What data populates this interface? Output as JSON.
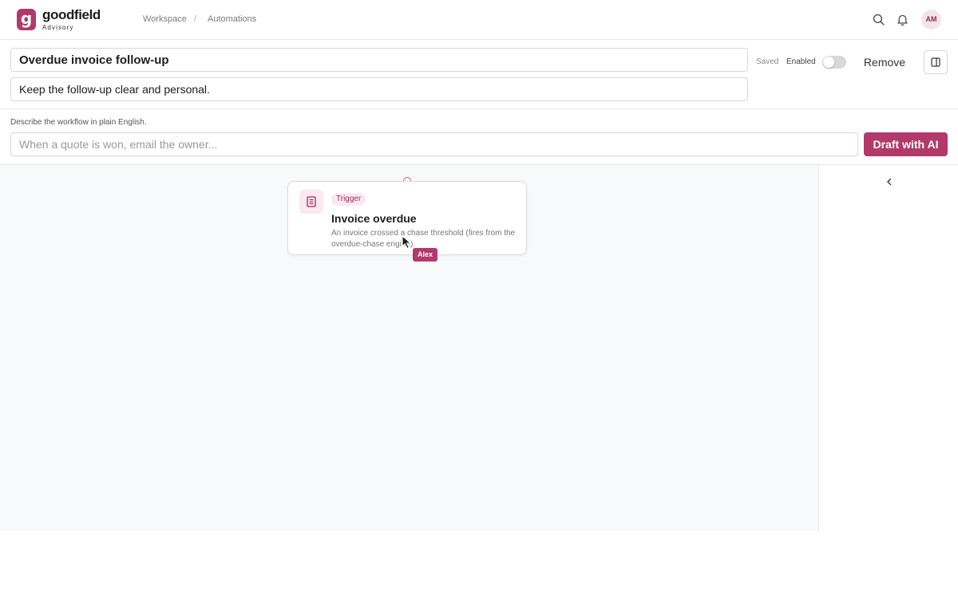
{
  "brand": {
    "logo_letter": "g",
    "name": "goodfield",
    "subtitle": "Advisory",
    "accent_color": "#b23a6b"
  },
  "breadcrumb": {
    "items": [
      "Workspace",
      "Automations"
    ],
    "separator": "/"
  },
  "header_icons": [
    "search-icon",
    "bell-icon"
  ],
  "user": {
    "initials": "AM"
  },
  "workflow": {
    "title": "Overdue invoice follow-up",
    "description": "Keep the follow-up clear and personal.",
    "save_status": "Saved",
    "enabled_label": "Enabled",
    "enabled": false,
    "remove_label": "Remove"
  },
  "prompt": {
    "label": "Describe the workflow in plain English.",
    "placeholder": "When a quote is won, email the owner...",
    "value": "",
    "button_label": "Draft with AI"
  },
  "canvas": {
    "nodes": [
      {
        "badge": "Trigger",
        "title": "Invoice overdue",
        "description": "An invoice crossed a chase threshold (fires from the overdue-chase engine).",
        "icon": "invoice-icon"
      }
    ],
    "collaborator_cursor": {
      "name": "Alex",
      "color": "#b23a6b"
    }
  }
}
